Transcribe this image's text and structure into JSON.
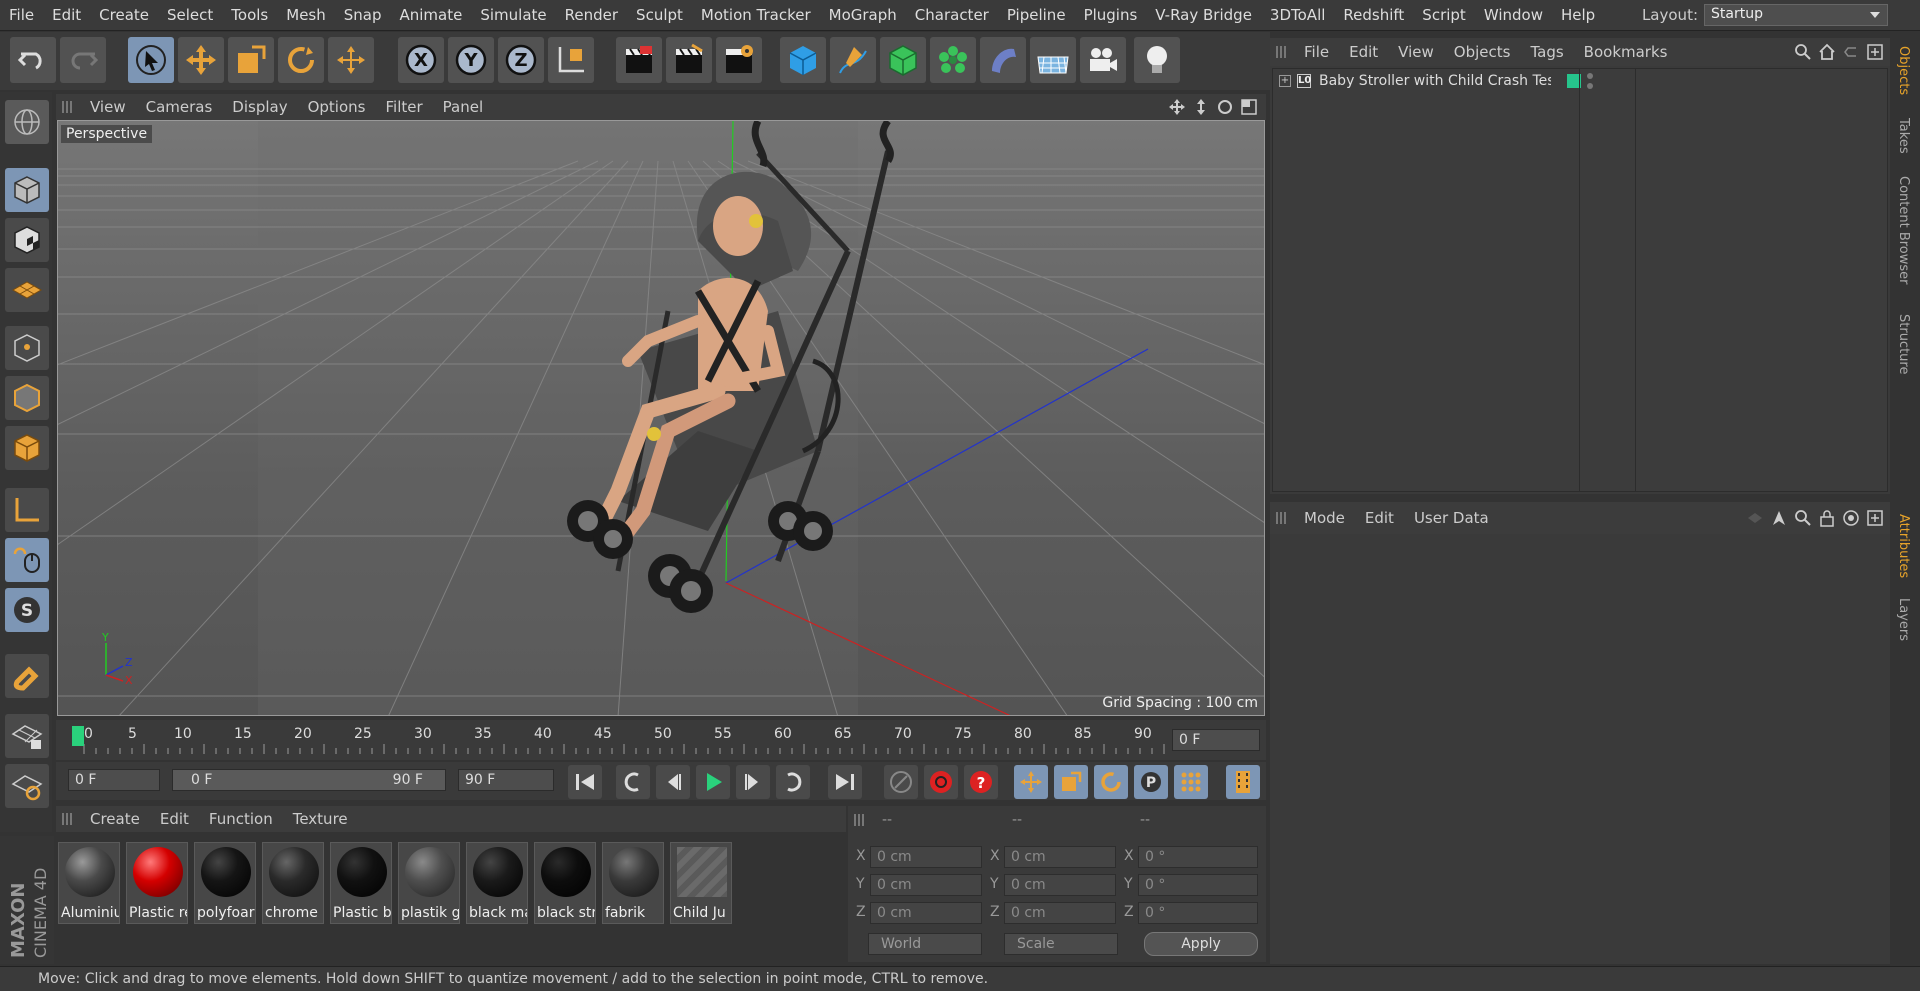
{
  "menubar": {
    "items": [
      "File",
      "Edit",
      "Create",
      "Select",
      "Tools",
      "Mesh",
      "Snap",
      "Animate",
      "Simulate",
      "Render",
      "Sculpt",
      "Motion Tracker",
      "MoGraph",
      "Character",
      "Pipeline",
      "Plugins",
      "V-Ray Bridge",
      "3DToAll",
      "Redshift",
      "Script",
      "Window",
      "Help"
    ],
    "layout_label": "Layout:",
    "layout_value": "Startup"
  },
  "viewport": {
    "menu": [
      "View",
      "Cameras",
      "Display",
      "Options",
      "Filter",
      "Panel"
    ],
    "camera_label": "Perspective",
    "grid_spacing": "Grid Spacing : 100 cm",
    "axis_labels": {
      "y": "Y",
      "z": "Z",
      "x": "X"
    }
  },
  "timeline": {
    "ticks": [
      "0",
      "5",
      "10",
      "15",
      "20",
      "25",
      "30",
      "35",
      "40",
      "45",
      "50",
      "55",
      "60",
      "65",
      "70",
      "75",
      "80",
      "85",
      "90"
    ],
    "current_frame": "0 F",
    "start_frame": "0 F",
    "range_start": "0 F",
    "range_end": "90 F",
    "end_frame": "90 F"
  },
  "materials": {
    "menu": [
      "Create",
      "Edit",
      "Function",
      "Texture"
    ],
    "items": [
      {
        "name": "Aluminiu",
        "color": "#4a4a4a"
      },
      {
        "name": "Plastic re",
        "color": "#d40000"
      },
      {
        "name": "polyfoar",
        "color": "#151515"
      },
      {
        "name": "chrome",
        "color": "#2a2a2a"
      },
      {
        "name": "Plastic b",
        "color": "#111111"
      },
      {
        "name": "plastik g",
        "color": "#4f4f4f"
      },
      {
        "name": "black ma",
        "color": "#1a1a1a"
      },
      {
        "name": "black str",
        "color": "#0d0d0d"
      },
      {
        "name": "fabrik",
        "color": "#3a3a3a"
      },
      {
        "name": "Child Ju",
        "color": "stripe"
      }
    ]
  },
  "coordinates": {
    "headers": [
      "--",
      "--",
      "--"
    ],
    "rows": [
      {
        "axis": "X",
        "pos": "0 cm",
        "size": "0 cm",
        "rot_label": "X",
        "rot": "0 °"
      },
      {
        "axis": "Y",
        "pos": "0 cm",
        "size": "0 cm",
        "rot_label": "Y",
        "rot": "0 °"
      },
      {
        "axis": "Z",
        "pos": "0 cm",
        "size": "0 cm",
        "rot_label": "Z",
        "rot": "0 °"
      }
    ],
    "mode": "World",
    "scale": "Scale",
    "apply": "Apply"
  },
  "objects": {
    "menu": [
      "File",
      "Edit",
      "View",
      "Objects",
      "Tags",
      "Bookmarks"
    ],
    "items": [
      {
        "name": "Baby Stroller with Child Crash Test",
        "tag_color": "#26c58c"
      }
    ]
  },
  "attributes": {
    "menu": [
      "Mode",
      "Edit",
      "User Data"
    ]
  },
  "right_tabs": {
    "upper": [
      "Objects",
      "Takes",
      "Content Browser",
      "Structure"
    ],
    "lower": [
      "Attributes",
      "Layers"
    ]
  },
  "status": "Move: Click and drag to move elements. Hold down SHIFT to quantize movement / add to the selection in point mode, CTRL to remove.",
  "brand": {
    "logo": "MAXON",
    "product": "CINEMA 4D"
  },
  "colors": {
    "accent_selected": "#7d96b5",
    "tool_orange": "#e8a33a",
    "x_axis": "#c22",
    "y_axis": "#2a2",
    "z_axis": "#23c"
  }
}
